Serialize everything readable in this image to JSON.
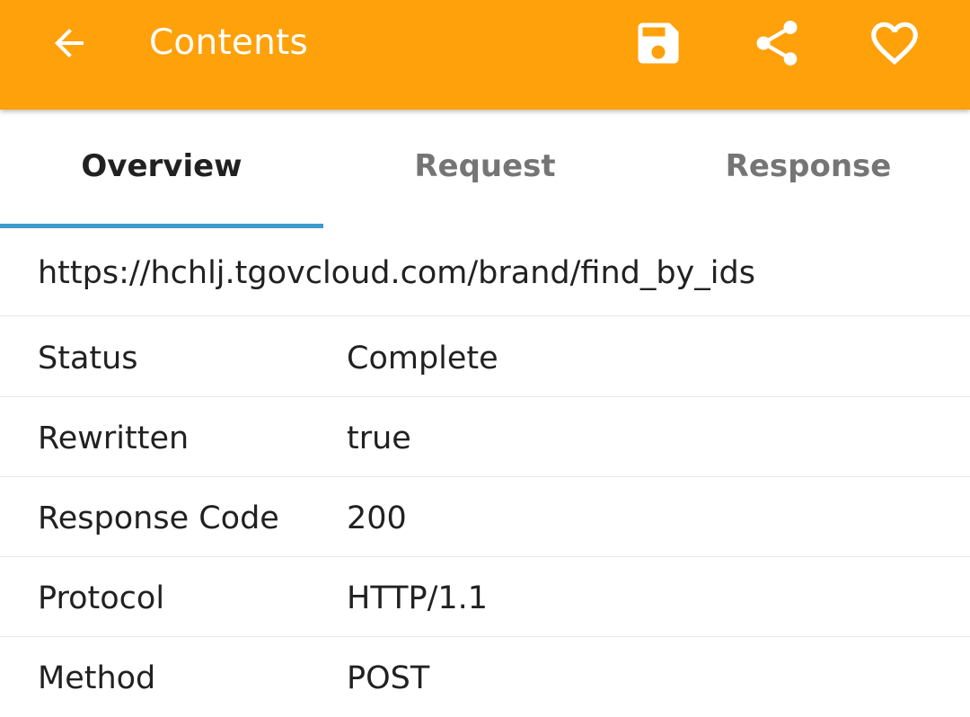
{
  "appbar": {
    "title": "Contents",
    "background_color": "#FFA10A",
    "icons": {
      "back": "arrow-back-icon",
      "save": "save-icon",
      "share": "share-icon",
      "favorite": "heart-outline-icon"
    }
  },
  "tabs": [
    {
      "label": "Overview",
      "active": true
    },
    {
      "label": "Request",
      "active": false
    },
    {
      "label": "Response",
      "active": false
    }
  ],
  "accent_color": "#3E9ACD",
  "overview": {
    "url": "https://hchlj.tgovcloud.com/brand/find_by_ids",
    "rows": [
      {
        "key": "Status",
        "value": "Complete"
      },
      {
        "key": "Rewritten",
        "value": "true"
      },
      {
        "key": "Response Code",
        "value": "200"
      },
      {
        "key": "Protocol",
        "value": "HTTP/1.1"
      },
      {
        "key": "Method",
        "value": "POST"
      }
    ]
  }
}
